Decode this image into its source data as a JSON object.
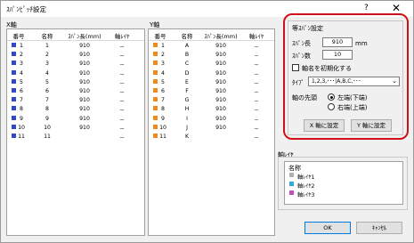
{
  "window": {
    "title": "ｽﾊﾟﾝﾋﾟｯﾁ設定",
    "help": "?",
    "close": "✕"
  },
  "x_axis": {
    "label": "X軸",
    "headers": [
      "番号",
      "名称",
      "ｽﾊﾟﾝ長(mm)",
      "軸ﾚｲﾔ"
    ],
    "rows": [
      {
        "no": "1",
        "name": "1",
        "span": "910",
        "layer": "－"
      },
      {
        "no": "2",
        "name": "2",
        "span": "910",
        "layer": "－"
      },
      {
        "no": "3",
        "name": "3",
        "span": "910",
        "layer": "－"
      },
      {
        "no": "4",
        "name": "4",
        "span": "910",
        "layer": "－"
      },
      {
        "no": "5",
        "name": "5",
        "span": "910",
        "layer": "－"
      },
      {
        "no": "6",
        "name": "6",
        "span": "910",
        "layer": "－"
      },
      {
        "no": "7",
        "name": "7",
        "span": "910",
        "layer": "－"
      },
      {
        "no": "8",
        "name": "8",
        "span": "910",
        "layer": "－"
      },
      {
        "no": "9",
        "name": "9",
        "span": "910",
        "layer": "－"
      },
      {
        "no": "10",
        "name": "10",
        "span": "910",
        "layer": "－"
      },
      {
        "no": "11",
        "name": "11",
        "span": "",
        "layer": "－"
      }
    ],
    "swatch_color": "#2e49c9"
  },
  "y_axis": {
    "label": "Y軸",
    "headers": [
      "番号",
      "名称",
      "ｽﾊﾟﾝ長(mm)",
      "軸ﾚｲﾔ"
    ],
    "rows": [
      {
        "no": "1",
        "name": "A",
        "span": "910",
        "layer": "－"
      },
      {
        "no": "2",
        "name": "B",
        "span": "910",
        "layer": "－"
      },
      {
        "no": "3",
        "name": "C",
        "span": "910",
        "layer": "－"
      },
      {
        "no": "4",
        "name": "D",
        "span": "910",
        "layer": "－"
      },
      {
        "no": "5",
        "name": "E",
        "span": "910",
        "layer": "－"
      },
      {
        "no": "6",
        "name": "F",
        "span": "910",
        "layer": "－"
      },
      {
        "no": "7",
        "name": "G",
        "span": "910",
        "layer": "－"
      },
      {
        "no": "8",
        "name": "H",
        "span": "910",
        "layer": "－"
      },
      {
        "no": "9",
        "name": "I",
        "span": "910",
        "layer": "－"
      },
      {
        "no": "10",
        "name": "J",
        "span": "910",
        "layer": "－"
      },
      {
        "no": "11",
        "name": "K",
        "span": "",
        "layer": "－"
      }
    ],
    "swatch_color": "#f08a1c"
  },
  "equal_span": {
    "title": "等ｽﾊﾟﾝ設定",
    "span_length_label": "ｽﾊﾟﾝ長",
    "span_length_value": "910",
    "span_length_unit": "mm",
    "span_count_label": "ｽﾊﾟﾝ数",
    "span_count_value": "10",
    "init_names_label": "軸名を初期化する",
    "type_label": "ﾀｲﾌﾟ",
    "type_value": "1,2,3,･･･|A,B,C,･･･",
    "axis_start_label": "軸の先頭",
    "radio_left": "左端(下端)",
    "radio_right": "右端(上端)",
    "x_button": "X 軸に設定",
    "y_button": "Y 軸に設定"
  },
  "axis_layer": {
    "label": "軸ﾚｲﾔ",
    "header": "名称",
    "items": [
      {
        "name": "軸ﾚｲﾔ1",
        "color": "#b0b0b0"
      },
      {
        "name": "軸ﾚｲﾔ2",
        "color": "#33aadd"
      },
      {
        "name": "軸ﾚｲﾔ3",
        "color": "#c050c0"
      }
    ]
  },
  "footer": {
    "ok": "OK",
    "cancel": "ｷｬﾝｾﾙ"
  },
  "colors": {
    "highlight_ring": "#d0101a",
    "ok_border": "#0078d7"
  }
}
